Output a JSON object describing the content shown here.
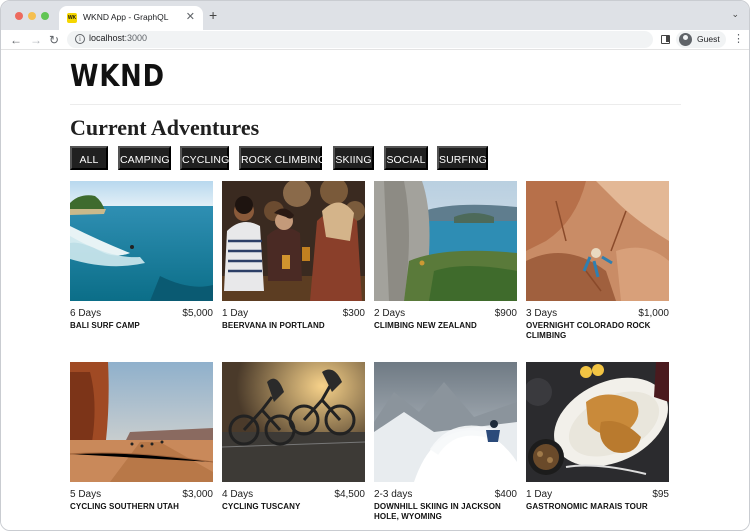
{
  "browser": {
    "tab_title": "WKND App - GraphQL",
    "favicon_text": "WK",
    "url_host": "localhost",
    "url_port": ":3000",
    "profile_label": "Guest"
  },
  "site": {
    "logo": "WKND",
    "heading": "Current Adventures"
  },
  "filters": [
    "ALL",
    "CAMPING",
    "CYCLING",
    "ROCK CLIMBING",
    "SKIING",
    "SOCIAL",
    "SURFING"
  ],
  "adventures": [
    {
      "duration": "6 Days",
      "price": "$5,000",
      "title": "BALI SURF CAMP",
      "image": "surf-ocean-image"
    },
    {
      "duration": "1 Day",
      "price": "$300",
      "title": "BEERVANA IN PORTLAND",
      "image": "brewery-friends-image"
    },
    {
      "duration": "2 Days",
      "price": "$900",
      "title": "CLIMBING NEW ZEALAND",
      "image": "cliff-climber-image"
    },
    {
      "duration": "3 Days",
      "price": "$1,000",
      "title": "OVERNIGHT COLORADO ROCK CLIMBING",
      "image": "red-rock-climber-image"
    },
    {
      "duration": "5 Days",
      "price": "$3,000",
      "title": "CYCLING SOUTHERN UTAH",
      "image": "desert-road-cyclists-image"
    },
    {
      "duration": "4 Days",
      "price": "$4,500",
      "title": "CYCLING TUSCANY",
      "image": "road-cyclists-sunset-image"
    },
    {
      "duration": "2-3 days",
      "price": "$400",
      "title": "DOWNHILL SKIING IN JACKSON HOLE, WYOMING",
      "image": "powder-skier-image"
    },
    {
      "duration": "1 Day",
      "price": "$95",
      "title": "GASTRONOMIC MARAIS TOUR",
      "image": "roast-chicken-platter-image"
    }
  ]
}
